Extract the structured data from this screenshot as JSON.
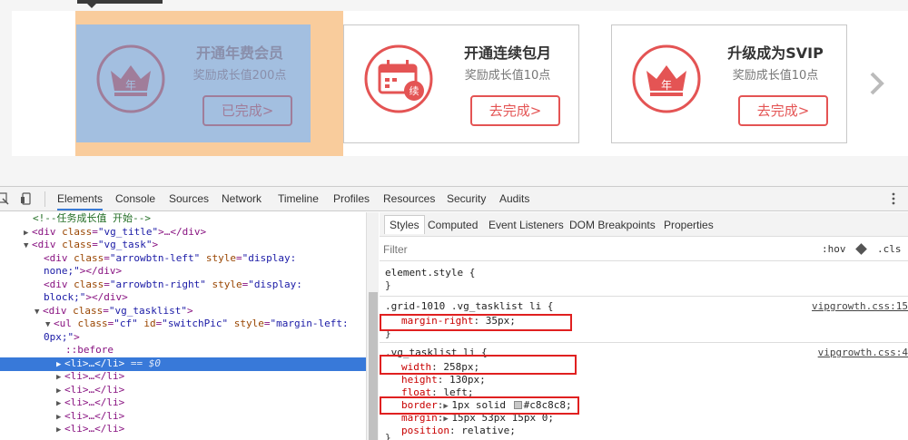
{
  "page": {
    "tasks": [
      {
        "title": "开通年费会员",
        "subtitle": "奖励成长值200点",
        "button": "已完成>",
        "icon": "crown-icon",
        "icon_text": "年"
      },
      {
        "title": "开通连续包月",
        "subtitle": "奖励成长值10点",
        "button": "去完成>",
        "icon": "calendar-icon",
        "icon_text": "续"
      },
      {
        "title": "升级成为SVIP",
        "subtitle": "奖励成长值10点",
        "button": "去完成>",
        "icon": "crown-icon",
        "icon_text": "年"
      }
    ],
    "next_arrow": "chevron-right-icon",
    "accent_color": "#e45454",
    "margin_color": "#f9cc9c",
    "content_color": "#a3bfe0"
  },
  "devtools": {
    "tabs": [
      "Elements",
      "Console",
      "Sources",
      "Network",
      "Timeline",
      "Profiles",
      "Resources",
      "Security",
      "Audits"
    ],
    "active_tab": "Elements",
    "elements": {
      "l0": "<!--任务成长值 开始-->",
      "l1_tag": "<div ",
      "l1_attr": "class",
      "l1_val": "\"vg_title\"",
      "l1_rest": ">…</div>",
      "l2_tag": "<div ",
      "l2_attr": "class",
      "l2_val": "\"vg_task\"",
      "l2_rest": ">",
      "l3_tag": "<div ",
      "l3_attr": "class",
      "l3_val": "\"arrowbtn-left\"",
      "l3_attr2": "style",
      "l3_val2": "\"display:",
      "l4_val": "none;\"",
      "l4_rest": "></div>",
      "l5_tag": "<div ",
      "l5_attr": "class",
      "l5_val": "\"arrowbtn-right\"",
      "l5_attr2": "style",
      "l5_val2": "\"display:",
      "l6_val": "block;\"",
      "l6_rest": "></div>",
      "l7_tag": "<div ",
      "l7_attr": "class",
      "l7_val": "\"vg_tasklist\"",
      "l7_rest": ">",
      "l8_tag": "<ul ",
      "l8_attr": "class",
      "l8_val": "\"cf\"",
      "l8_attr2": "id",
      "l8_val2": "\"switchPic\"",
      "l8_attr3": "style",
      "l8_val3": "\"margin-left:",
      "l9_val": "0px;\"",
      "l9_rest": ">",
      "l10": "::before",
      "li_tag": "<li>…</li>",
      "selected_mark": " == $0"
    },
    "styles": {
      "tabs": [
        "Styles",
        "Computed",
        "Event Listeners",
        "DOM Breakpoints",
        "Properties"
      ],
      "active_tab": "Styles",
      "filter_placeholder": "Filter",
      "hov": ":hov",
      "cls": ".cls",
      "element_style": "element.style {",
      "close": "}",
      "rule1": {
        "selector": ".grid-1010 .vg_tasklist li {",
        "source": "vipgrowth.css:15",
        "decls": [
          {
            "name": "margin-right",
            "value": "35px;"
          }
        ]
      },
      "rule2": {
        "selector": ".vg_tasklist li {",
        "source": "vipgrowth.css:4",
        "decls": [
          {
            "name": "width",
            "value": "258px;"
          },
          {
            "name": "height",
            "value": "130px;"
          },
          {
            "name": "float",
            "value": "left;"
          },
          {
            "name": "border",
            "value": "1px solid",
            "color": "#c8c8c8;"
          },
          {
            "name": "margin",
            "value": "15px 53px 15px 0;"
          },
          {
            "name": "position",
            "value": "relative;"
          }
        ]
      }
    }
  }
}
